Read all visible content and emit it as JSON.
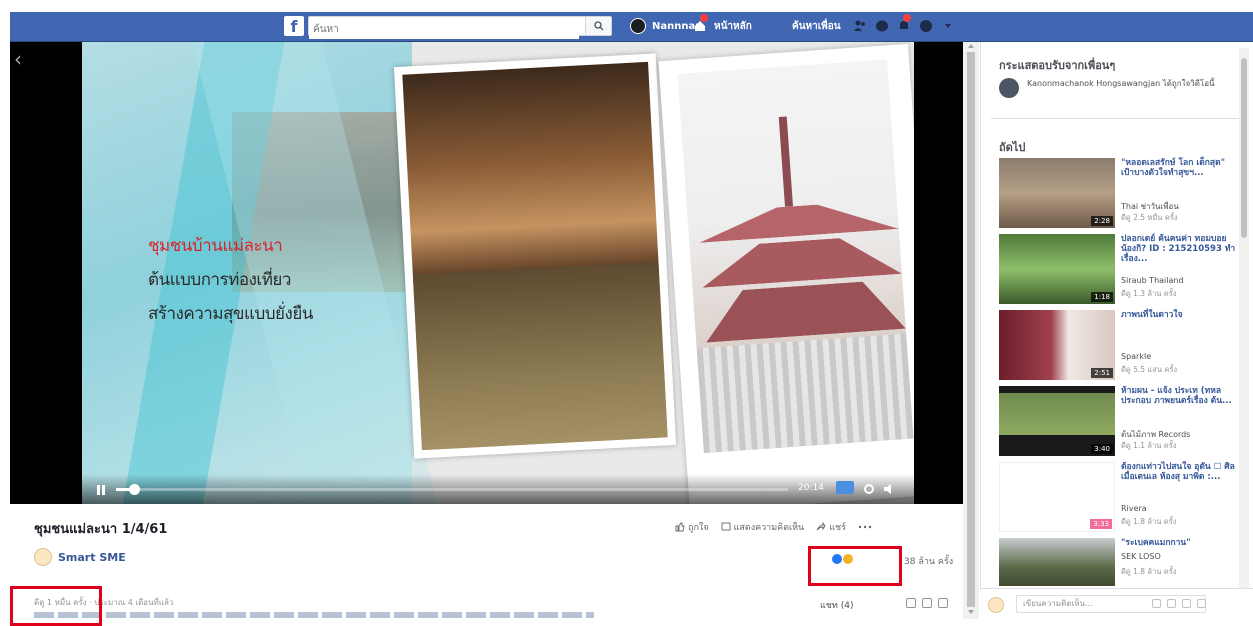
{
  "topbar": {
    "search_placeholder": "ค้นหา",
    "profile_name": "Nannnan",
    "nav_home": "หน้าหลัก",
    "nav_find_friends": "ค้นหาเพื่อน"
  },
  "video": {
    "overlay_lines": [
      "ชุมชนบ้านแม่ละนา",
      "ต้นแบบการท่องเที่ยว",
      "สร้างความสุขแบบยั่งยืน"
    ],
    "time": "20:14",
    "progress": 0.02
  },
  "post": {
    "title": "ชุมชนแม่ละนา 1/4/61",
    "page_name": "Smart SME",
    "action_like": "ถูกใจ",
    "action_comment": "แสดงความคิดเห็น",
    "action_share": "แชร์",
    "views": "38 ล้าน ครั้ง",
    "meta": "ดีดู 1 หมื่น ครั้ง · ประมาณ 4 เดือนที่แล้ว",
    "comment_sort": "แชท (4)"
  },
  "sidebar": {
    "friends_heading": "กระแสตอบรับจากเพื่อนๆ",
    "friend_text": "Kanonmachanok Hongsawangjan ได้ถูกใจวิดีโอนี้",
    "next_heading": "ถัดไป",
    "recommendations": [
      {
        "title": "\"หลอดเลสรักษ์ โลก เด็กสุด\" เป้าบางตัวใจทำสุขฯ...",
        "source": "Thai ช่าวันเพื่อน",
        "views": "ดีดู 2.5 หมื่น ครั้ง",
        "duration": "2:28"
      },
      {
        "title": "ปลอกเดย์ ค้นคนค่า ทอมบอยน้องกิ? ID : 215210593 ทำเรื่อง...",
        "source": "Siraub Thailand",
        "views": "ดีดู 1.3 ล้าน ครั้ง",
        "duration": "1:18"
      },
      {
        "title": "ภาพนที่ในดาวใจ",
        "source": "Sparkle",
        "views": "ดีดู 5.5 แสน ครั้ง",
        "duration": "2:51"
      },
      {
        "title": "ห้ามผน - แจ้ง ประเท (ทหลประกอบ ภาพยนตร์เรื่อง ต้น...",
        "source": "ต้นไม้ภาพ Records",
        "views": "ดีดู 1.1 ล้าน ครั้ง",
        "duration": "3:40"
      },
      {
        "title": "ต้องกแท่าวไปสนใจ อุตัน ☐ ศิลเมื่อเตนเล ห้องสุ มาพิด :...",
        "source": "Rivera",
        "views": "ดีดู 1.8 ล้าน ครั้ง",
        "duration": "3:33"
      },
      {
        "title": "\"ระเบคคแมกกาน\"",
        "source": "SEK LOSO",
        "views": "ดีดู 1.8 ล้าน ครั้ง",
        "duration": ""
      }
    ]
  },
  "chat": {
    "placeholder": "เขียนความคิดเห็น..."
  },
  "colors": {
    "facebook_blue": "#4267b2",
    "link_blue": "#365899",
    "highlight_red": "#e0001a"
  }
}
